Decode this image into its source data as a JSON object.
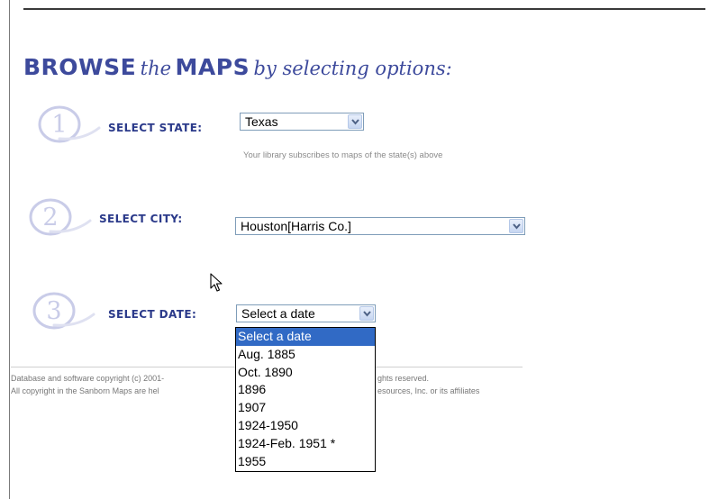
{
  "heading": {
    "part1": "BROWSE",
    "part2": "the",
    "part3": "MAPS",
    "part4": "by selecting options:"
  },
  "steps": [
    {
      "number": "1",
      "label": "SELECT STATE:",
      "value": "Texas"
    },
    {
      "number": "2",
      "label": "SELECT CITY:",
      "value": "Houston[Harris Co.]"
    },
    {
      "number": "3",
      "label": "SELECT DATE:",
      "value": "Select a date"
    }
  ],
  "state_hint": "Your library subscribes to maps of the state(s) above",
  "date_options": [
    "Select a date",
    "Aug. 1885",
    "Oct. 1890",
    "1896",
    "1907",
    "1924-1950",
    "1924-Feb. 1951 *",
    "1955"
  ],
  "footer": {
    "line1_left": "Database and software copyright (c) 2001-",
    "line1_right": "ghts reserved.",
    "line2_left": "All copyright in the Sanborn Maps are hel",
    "line2_right": "esources, Inc. or its affiliates"
  },
  "colors": {
    "heading": "#3d4a9c",
    "label": "#2b3a8a",
    "badge": "#c9cce8",
    "selection": "#316ac5"
  }
}
